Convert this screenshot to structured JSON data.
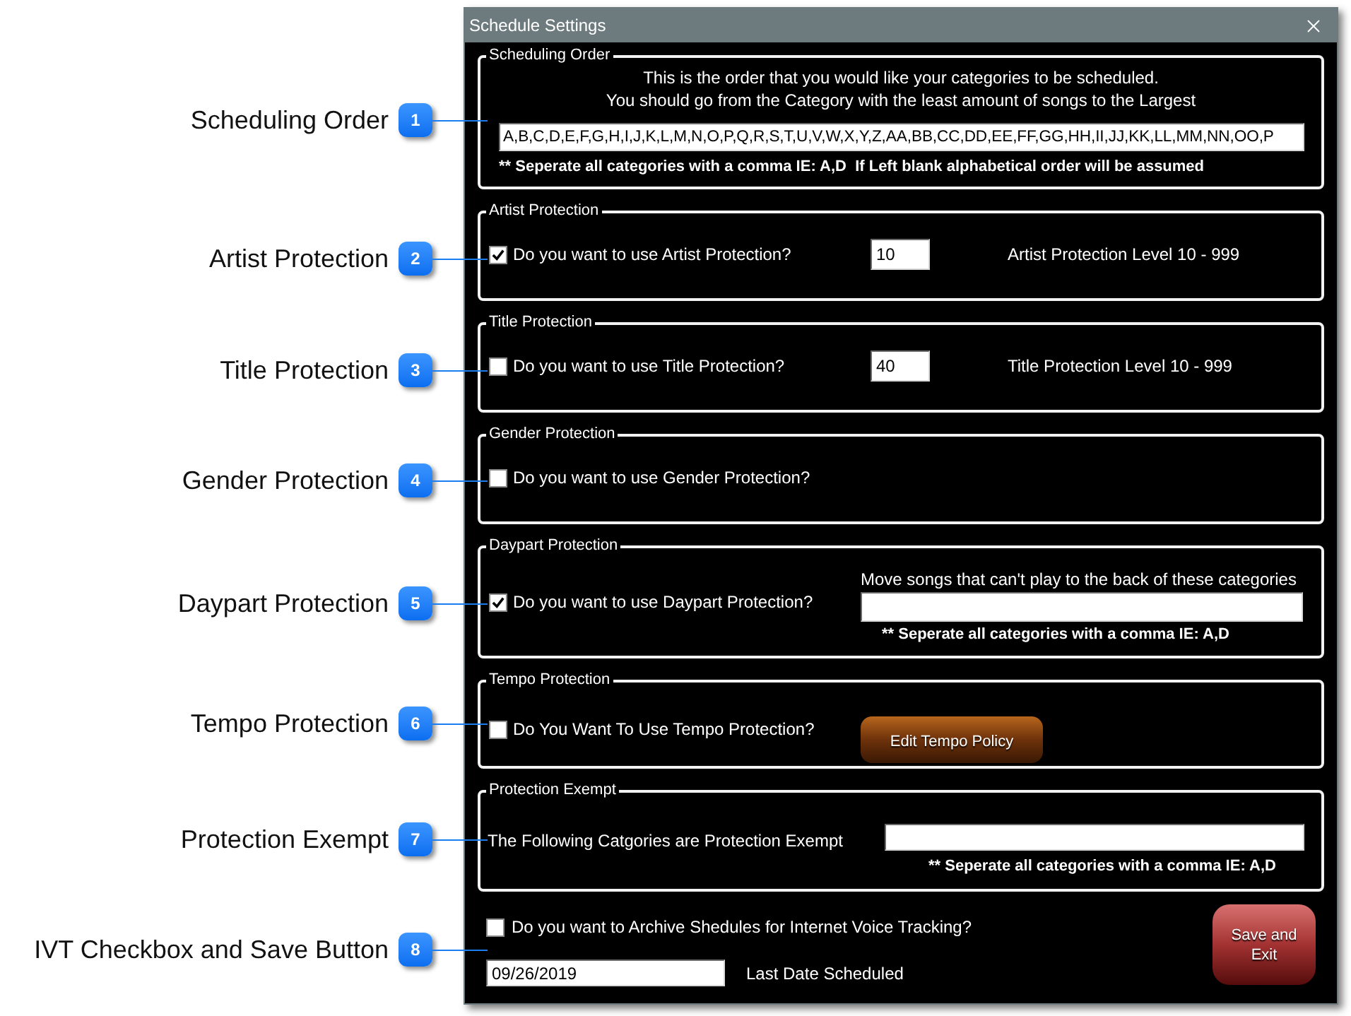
{
  "callouts": [
    {
      "number": "1",
      "label": "Scheduling Order"
    },
    {
      "number": "2",
      "label": "Artist Protection"
    },
    {
      "number": "3",
      "label": "Title Protection"
    },
    {
      "number": "4",
      "label": "Gender Protection"
    },
    {
      "number": "5",
      "label": "Daypart Protection"
    },
    {
      "number": "6",
      "label": "Tempo Protection"
    },
    {
      "number": "7",
      "label": "Protection Exempt"
    },
    {
      "number": "8",
      "label": "IVT Checkbox and Save Button"
    }
  ],
  "window": {
    "title": "Schedule Settings"
  },
  "sections": [
    {
      "kind": "order",
      "legend": "Scheduling Order",
      "instructions": [
        "This is the order that you would like your categories to be scheduled.",
        "You should go from the Category with the least amount of songs to the Largest"
      ],
      "value": "A,B,C,D,E,F,G,H,I,J,K,L,M,N,O,P,Q,R,S,T,U,V,W,X,Y,Z,AA,BB,CC,DD,EE,FF,GG,HH,II,JJ,KK,LL,MM,NN,OO,P",
      "note": "** Seperate all categories with a comma IE: A,D  If Left blank alphabetical order will be assumed"
    },
    {
      "kind": "level",
      "legend": "Artist Protection",
      "question": "Do you want to use Artist Protection?",
      "checked": true,
      "value": "10",
      "range": "Artist Protection Level 10 - 999"
    },
    {
      "kind": "level",
      "legend": "Title Protection",
      "question": "Do you want to use Title Protection?",
      "checked": false,
      "value": "40",
      "range": "Title Protection Level 10 - 999"
    },
    {
      "kind": "toggle",
      "legend": "Gender Protection",
      "question": "Do you want to use Gender Protection?",
      "checked": false
    },
    {
      "kind": "categories",
      "legend": "Daypart Protection",
      "question": "Do you want to use Daypart Protection?",
      "checked": true,
      "field_label": "Move songs that can't play to the back of these categories",
      "note": "** Seperate all categories with a comma IE: A,D"
    },
    {
      "kind": "button",
      "legend": "Tempo Protection",
      "question": "Do You Want To Use Tempo Protection?",
      "checked": false,
      "button": "Edit Tempo Policy"
    },
    {
      "kind": "exempt",
      "legend": "Protection Exempt",
      "text": "The Following Catgories are Protection Exempt",
      "note": "** Seperate all categories with a comma IE: A,D"
    }
  ],
  "archive": {
    "question": "Do you want to Archive Shedules for Internet Voice Tracking?",
    "checked": false,
    "date": "09/26/2019",
    "date_label": "Last Date Scheduled"
  },
  "save_button": "Save and Exit"
}
